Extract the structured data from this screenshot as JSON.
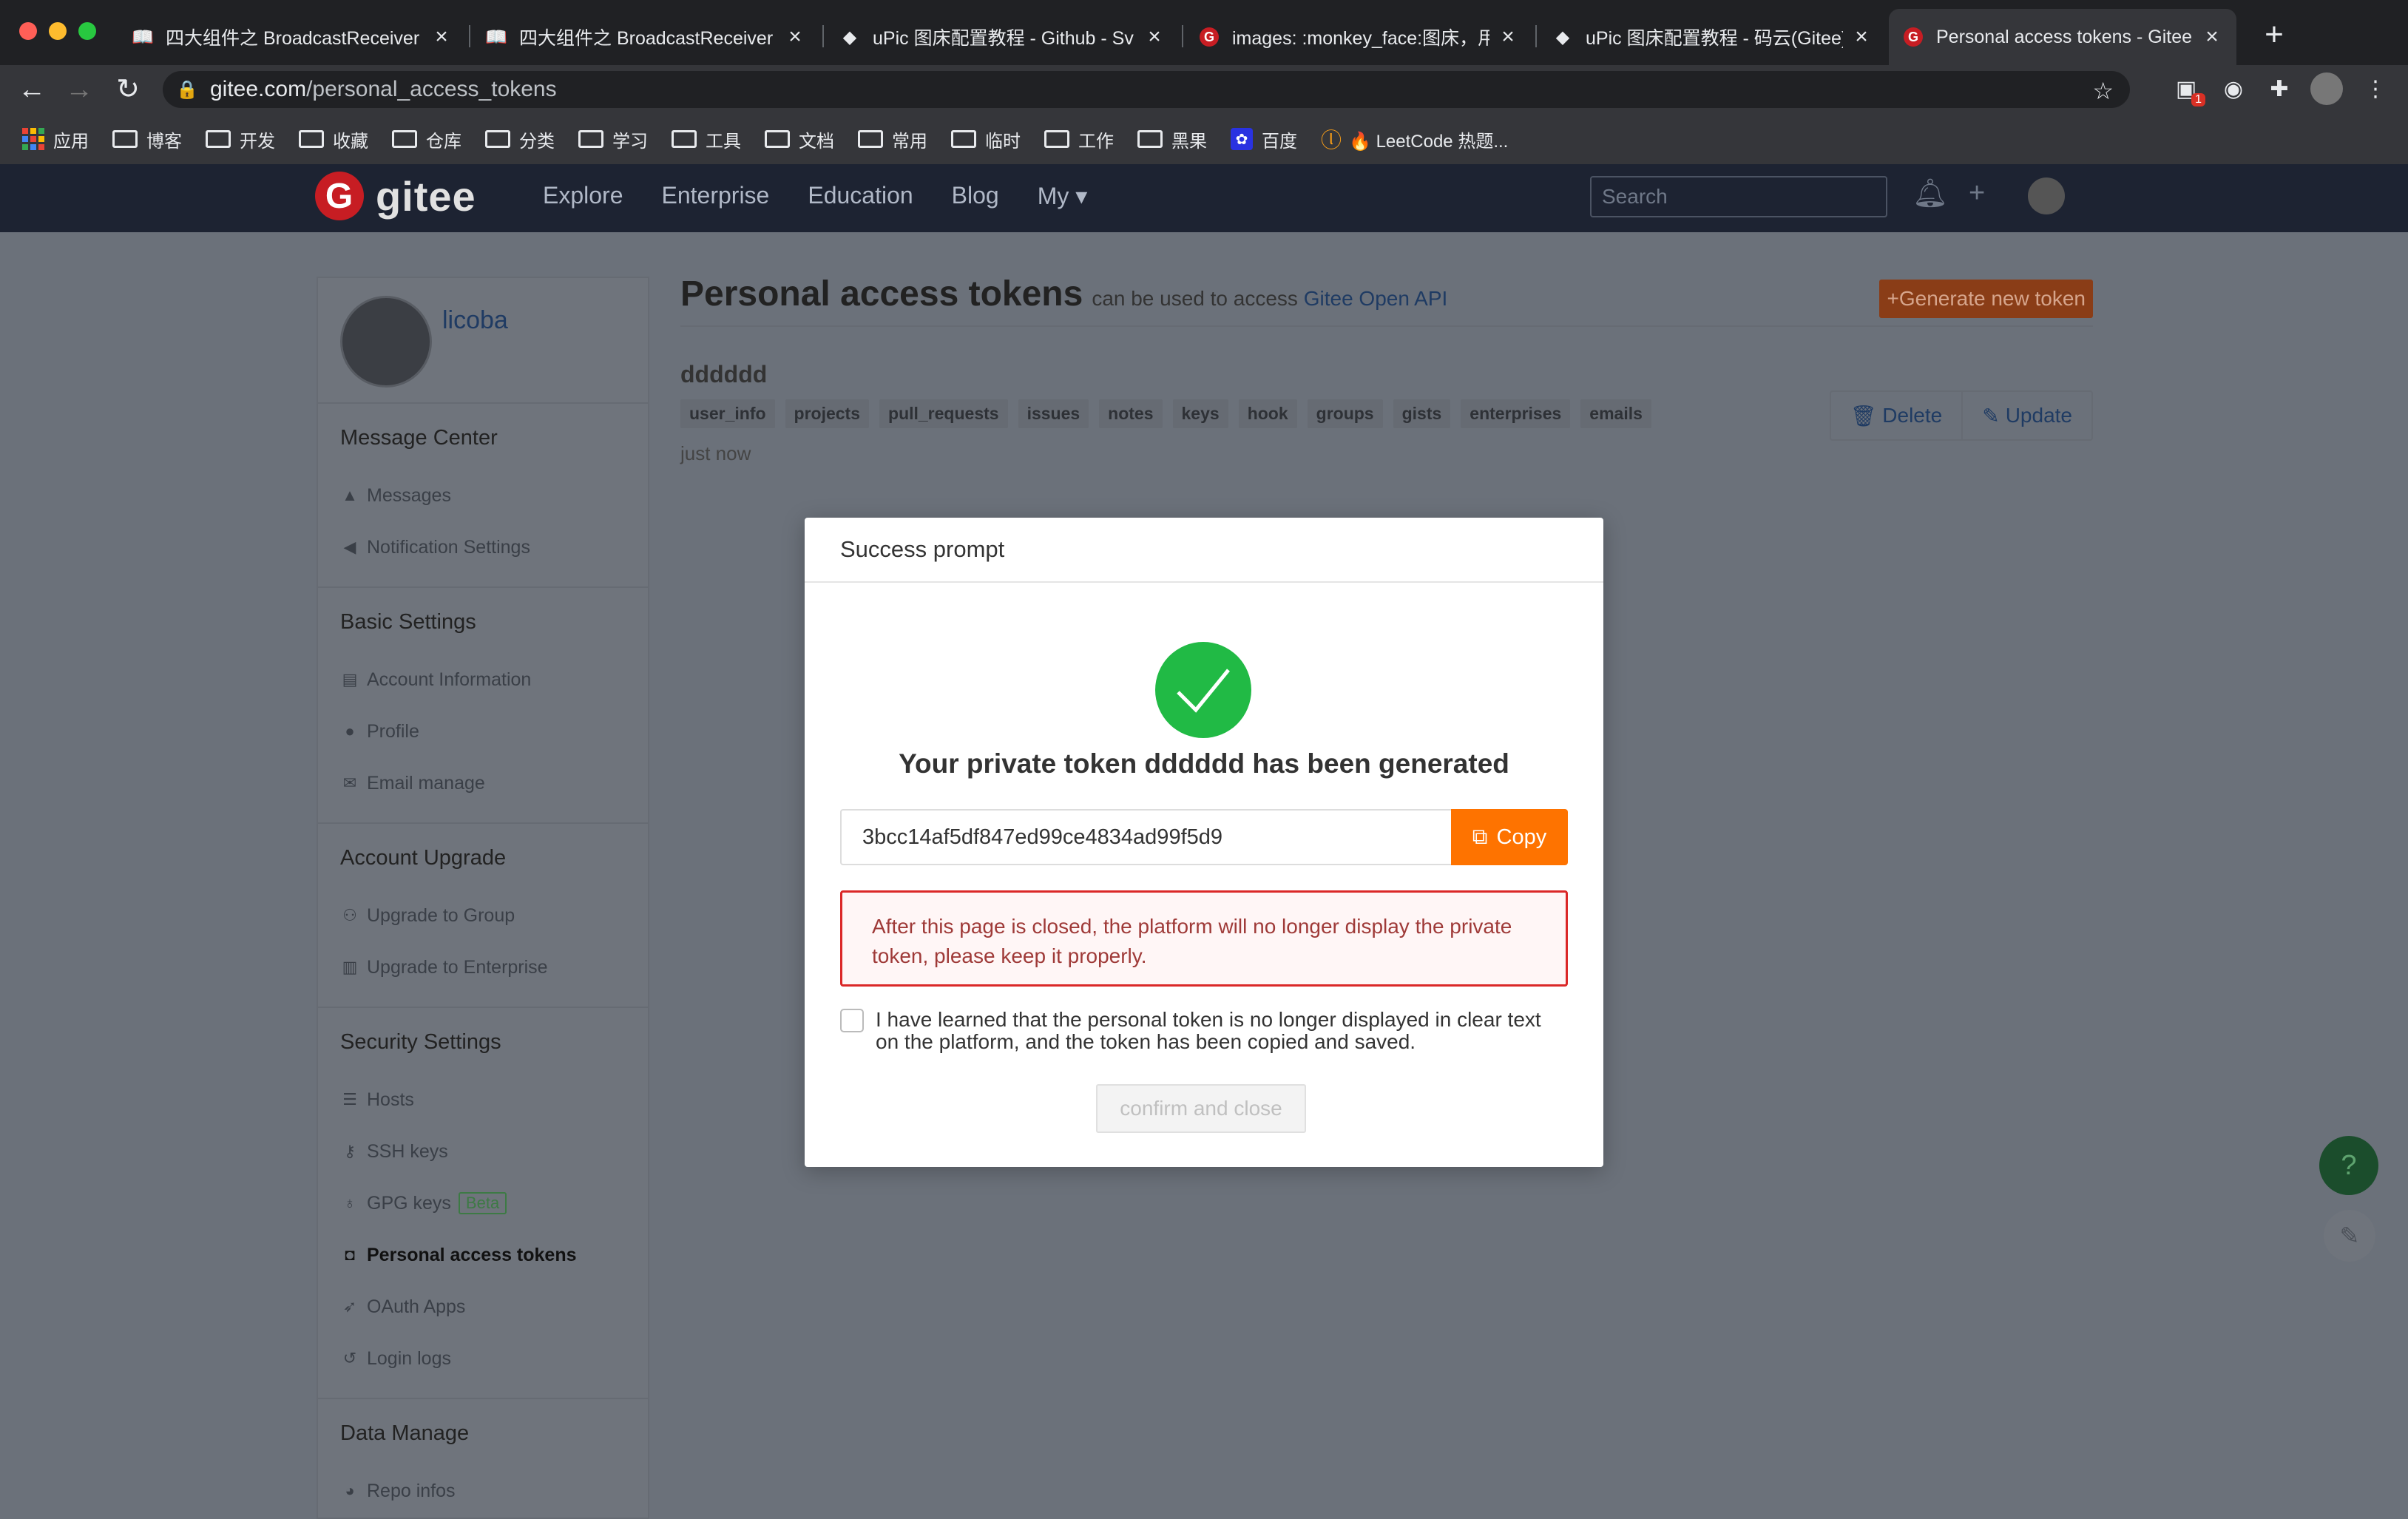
{
  "browser": {
    "tabs": [
      {
        "title": "四大组件之 BroadcastReceiver",
        "favicon": "book-icon"
      },
      {
        "title": "四大组件之 BroadcastReceiver",
        "favicon": "book-icon"
      },
      {
        "title": "uPic 图床配置教程 - Github - Sv",
        "favicon": "github-icon"
      },
      {
        "title": "images: :monkey_face:图床，用",
        "favicon": "gitee-icon"
      },
      {
        "title": "uPic 图床配置教程 - 码云(Gitee)",
        "favicon": "github-icon"
      },
      {
        "title": "Personal access tokens - Gitee",
        "favicon": "gitee-icon"
      }
    ],
    "url_domain": "gitee.com",
    "url_path": "/personal_access_tokens",
    "extension_badge": "1",
    "bookmarks": [
      "应用",
      "博客",
      "开发",
      "收藏",
      "仓库",
      "分类",
      "学习",
      "工具",
      "文档",
      "常用",
      "临时",
      "工作",
      "黑果",
      "百度",
      "🔥 LeetCode 热题..."
    ]
  },
  "gitee_header": {
    "brand": "gitee",
    "nav": [
      "Explore",
      "Enterprise",
      "Education",
      "Blog",
      "My ▾"
    ],
    "search_placeholder": "Search"
  },
  "sidebar": {
    "username": "licoba",
    "groups": [
      {
        "title": "Message Center",
        "items": [
          "Messages",
          "Notification Settings"
        ]
      },
      {
        "title": "Basic Settings",
        "items": [
          "Account Information",
          "Profile",
          "Email manage"
        ]
      },
      {
        "title": "Account Upgrade",
        "items": [
          "Upgrade to Group",
          "Upgrade to Enterprise"
        ]
      },
      {
        "title": "Security Settings",
        "items": [
          "Hosts",
          "SSH keys",
          "GPG keys",
          "Personal access tokens",
          "OAuth Apps",
          "Login logs"
        ]
      },
      {
        "title": "Data Manage",
        "items": [
          "Repo infos"
        ]
      }
    ],
    "beta_label": "Beta"
  },
  "main": {
    "title": "Personal access tokens",
    "subtitle_prefix": "can be used to access",
    "subtitle_link": "Gitee Open API",
    "generate_button": "+Generate new token",
    "token": {
      "name": "dddddd",
      "scopes": [
        "user_info",
        "projects",
        "pull_requests",
        "issues",
        "notes",
        "keys",
        "hook",
        "groups",
        "gists",
        "enterprises",
        "emails"
      ],
      "time": "just now",
      "delete_label": "Delete",
      "update_label": "Update"
    }
  },
  "modal": {
    "header": "Success prompt",
    "title": "Your private token dddddd has been generated",
    "token_value": "3bcc14af5df847ed99ce4834ad99f5d9",
    "copy_label": "Copy",
    "warning": "After this page is closed, the platform will no longer display the private token, please keep it properly.",
    "agree_text": "I have learned that the personal token is no longer displayed in clear text on the platform, and the token has been copied and saved.",
    "confirm_label": "confirm and close"
  },
  "colors": {
    "accent": "#fe7300",
    "success": "#21ba45",
    "danger": "#db2828",
    "brand": "#c71d23"
  }
}
